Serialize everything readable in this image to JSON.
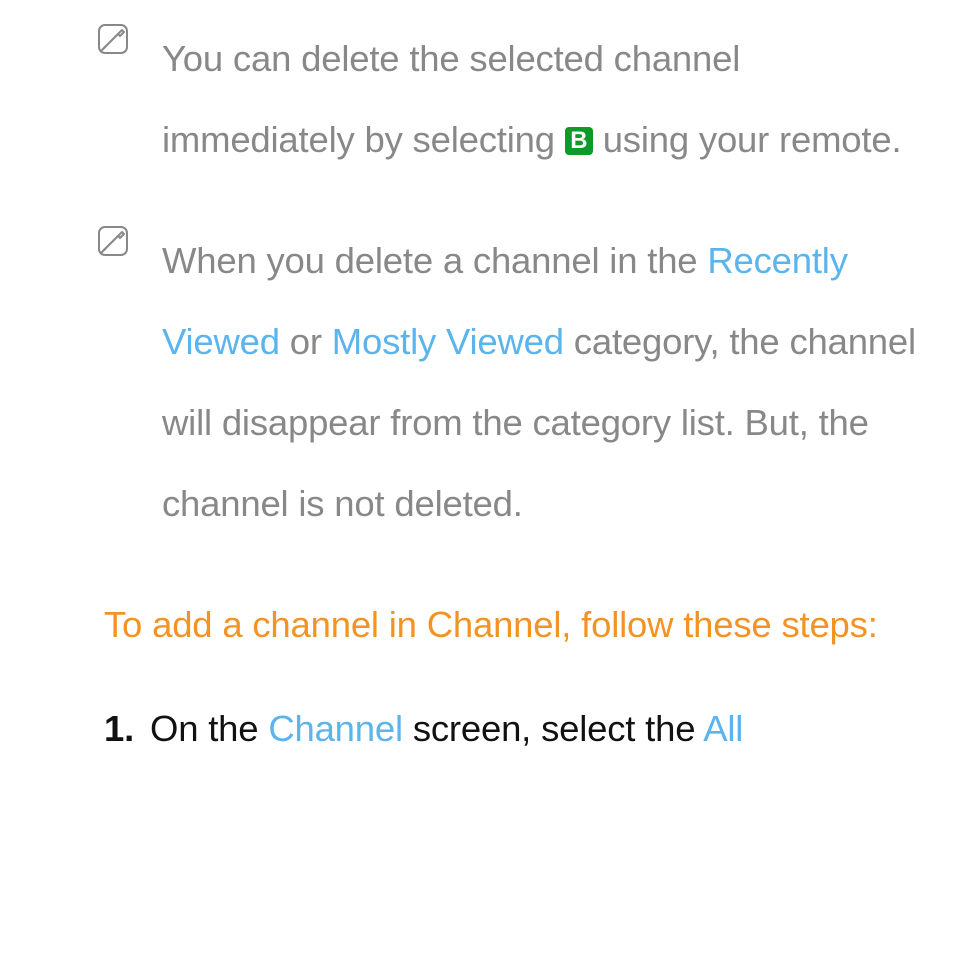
{
  "note1": {
    "t1": "You can delete the selected channel immediately by selecting ",
    "badge": "B",
    "t2": " using your remote."
  },
  "note2": {
    "t1": "When you delete a channel in the ",
    "blue1": "Recently Viewed",
    "t2": " or ",
    "blue2": "Mostly Viewed",
    "t3": " category, the channel will disappear from the category list. But, the channel is not deleted."
  },
  "heading": "To add a channel in Channel, follow these steps:",
  "step1": {
    "num": "1.",
    "t1": "On the ",
    "blue1": "Channel",
    "t2": " screen, select the ",
    "blue2": "All"
  }
}
